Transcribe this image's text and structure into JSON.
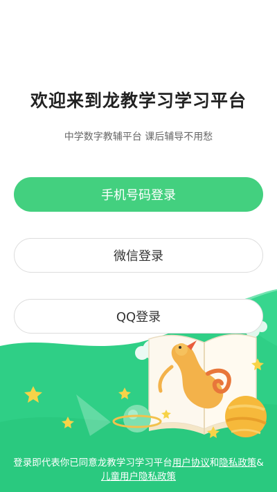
{
  "header": {
    "title": "欢迎来到龙教学习学习平台",
    "subtitle": "中学数字教辅平台 课后辅导不用愁"
  },
  "login": {
    "phone_label": "手机号码登录",
    "wechat_label": "微信登录",
    "qq_label": "QQ登录"
  },
  "agreement": {
    "prefix": "登录即代表你已同意龙教学习学习平台",
    "user_agreement": "用户协议",
    "and": "和",
    "privacy_policy": "隐私政策",
    "amp": "&",
    "child_privacy_policy": "儿童用户隐私政策"
  },
  "colors": {
    "accent": "#43d07f",
    "illustration_green": "#2fcf86",
    "illustration_green_dark": "#22b870"
  }
}
